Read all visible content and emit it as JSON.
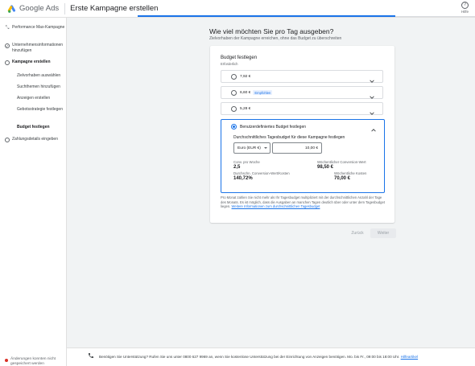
{
  "header": {
    "product_name": "Google Ads",
    "page_title": "Erste Kampagne erstellen",
    "help_label": "Hilfe"
  },
  "sidebar": {
    "steps": [
      {
        "label": "Performance Max-Kampagne",
        "status": "done"
      },
      {
        "label": "Unternehmensinformationen hinzufügen",
        "status": "done"
      },
      {
        "label": "Kampagne erstellen",
        "status": "current"
      },
      {
        "label": "Zahlungsdetails eingeben",
        "status": "pending"
      }
    ],
    "substeps": [
      {
        "label": "Zielvorhaben auswählen",
        "active": false
      },
      {
        "label": "Suchthemen hinzufügen",
        "active": false
      },
      {
        "label": "Anzeigen erstellen",
        "active": false
      },
      {
        "label": "Gebotsstrategie festlegen",
        "active": false
      },
      {
        "label": "Budget festlegen",
        "active": true
      }
    ],
    "unsaved_notice": "Änderungen konnten nicht gespeichert werden"
  },
  "main": {
    "heading": "Wie viel möchten Sie pro Tag ausgeben?",
    "subheading": "Zielvorhaben der Kampagne erreichen, ohne das Budget zu überschreiten",
    "card": {
      "title": "Budget festlegen",
      "required": "Erforderlich",
      "options": [
        {
          "label": "7,92 €",
          "tag": ""
        },
        {
          "label": "6,60 €",
          "tag": "Empfohlen"
        },
        {
          "label": "5,28 €",
          "tag": ""
        }
      ],
      "custom": {
        "label": "Benutzerdefiniertes Budget festlegen",
        "avg_label": "Durchschnittliches Tagesbudget für diese Kampagne festlegen",
        "currency": "Euro (EUR €)",
        "amount": "10,00 €",
        "metrics": [
          {
            "label": "Conv. pro Woche",
            "value": "2,5"
          },
          {
            "label": "Wöchentlicher Conversion-Wert",
            "value": "98,50 €"
          },
          {
            "label": "Durchschn. Conversion-Wert/Kosten",
            "value": "140,72%"
          },
          {
            "label": "Wöchentliche Kosten",
            "value": "70,00 €"
          }
        ]
      },
      "footnote": "Pro Monat zahlen Sie nicht mehr als Ihr Tagesbudget multipliziert mit der durchschnittlichen Anzahl der Tage des Monats. Es ist möglich, dass die Ausgaben an manchen Tagen deutlich über oder unter dem Tagesbudget liegen.",
      "footnote_link": "Weitere Informationen zum durchschnittlichen Tagesbudget"
    },
    "back_label": "Zurück",
    "next_label": "Weiter"
  },
  "support": {
    "text": "Benötigen Sie Unterstützung? Rufen Sie uns unter 0800 627 9969 an, wenn Sie kostenlose Unterstützung bei der Einrichtung von Anzeigen benötigen. Mo. bis Fr., 09:00 bis 18:00 Uhr.",
    "link": "Hilfeartikel"
  },
  "colors": {
    "accent": "#1a73e8",
    "google_blue": "#4285f4",
    "google_yellow": "#fbbc04",
    "google_green": "#34a853",
    "error": "#d93025"
  }
}
